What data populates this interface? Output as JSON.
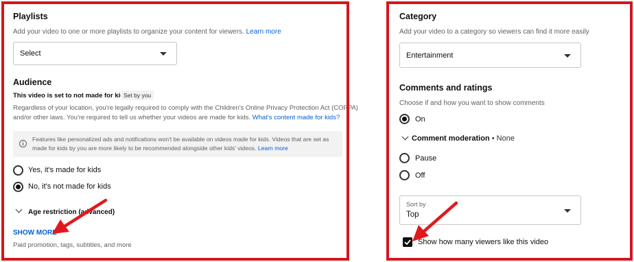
{
  "left": {
    "playlists": {
      "title": "Playlists",
      "description": "Add your video to one or more playlists to organize your content for viewers.",
      "learn_more": "Learn more",
      "select_value": "Select"
    },
    "audience": {
      "title": "Audience",
      "status": "This video is set to not made for kids",
      "badge": "Set by you",
      "legal_line1": "Regardless of your location, you're legally required to comply with the Children's Online Privacy Protection Act (COPPA)",
      "legal_line2": "and/or other laws. You're required to tell us whether your videos are made for kids.",
      "legal_link": "What's content made for kids?",
      "notice_line1": "Features like personalized ads and notifications won't be available on videos made for kids. Videos that are set as",
      "notice_line2": "made for kids by you are more likely to be recommended alongside other kids' videos.",
      "notice_link": "Learn more",
      "options": [
        {
          "label": "Yes, it's made for kids",
          "selected": false
        },
        {
          "label": "No, it's not made for kids",
          "selected": true
        }
      ]
    },
    "age_restriction": "Age restriction (advanced)",
    "show_more": "SHOW MORE",
    "show_more_desc": "Paid promotion, tags, subtitles, and more"
  },
  "right": {
    "category": {
      "title": "Category",
      "description": "Add your video to a category so viewers can find it more easily",
      "value": "Entertainment"
    },
    "comments": {
      "title": "Comments and ratings",
      "description": "Choose if and how you want to show comments",
      "on_label": "On",
      "moderation_label": "Comment moderation",
      "moderation_value": "• None",
      "pause_label": "Pause",
      "off_label": "Off",
      "sort_label": "Sort by",
      "sort_value": "Top",
      "likes_label": "Show how many viewers like this video",
      "likes_checked": true
    }
  },
  "colors": {
    "frame": "#d6151f",
    "arrow": "#e0191f",
    "link": "#065fd4"
  }
}
